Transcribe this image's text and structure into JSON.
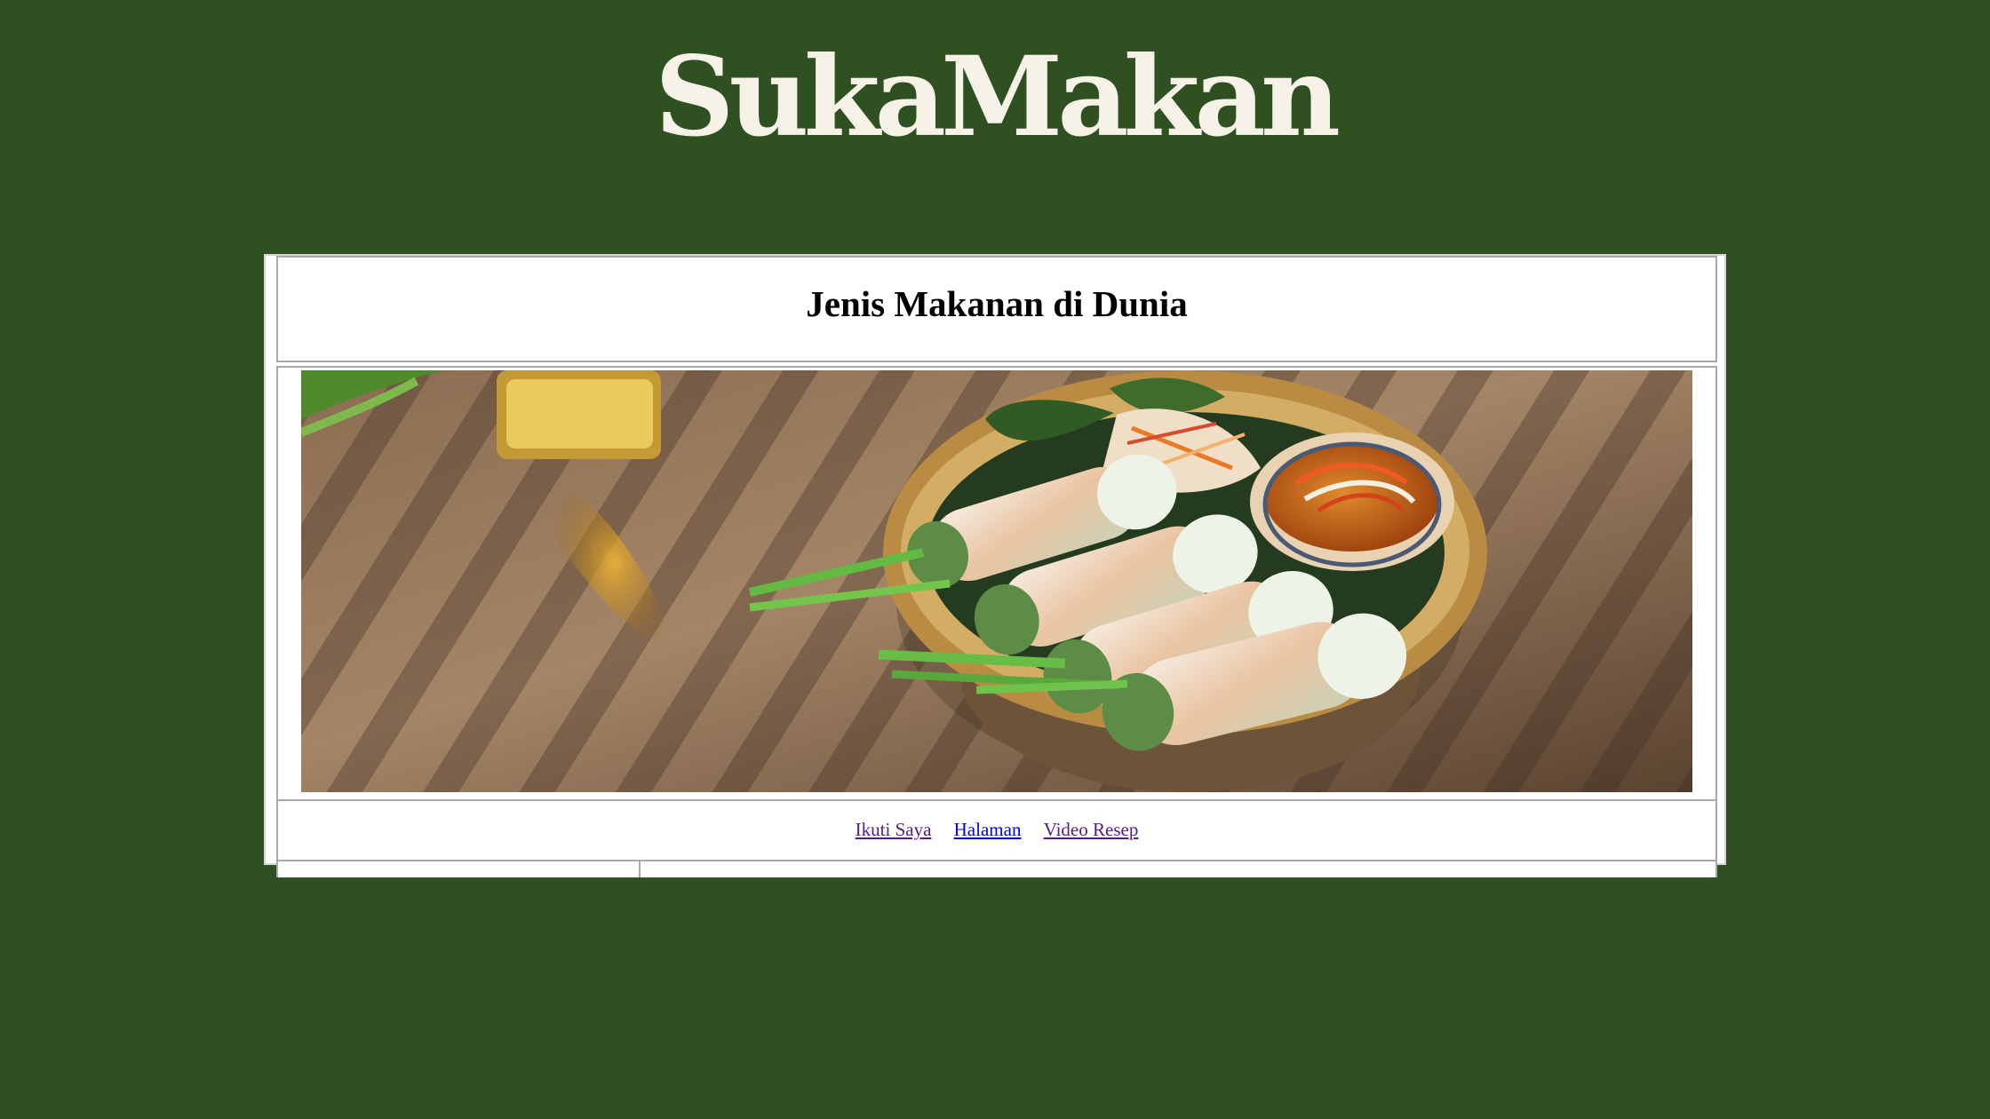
{
  "brand": {
    "logo_text": "SukaMakan"
  },
  "header": {
    "title": "Jenis Makanan di Dunia"
  },
  "hero": {
    "icon": "food-photo"
  },
  "nav": {
    "items": [
      {
        "label": "Ikuti Saya"
      },
      {
        "label": "Halaman"
      },
      {
        "label": "Video Resep"
      }
    ]
  },
  "colors": {
    "page_background": "#2f5020",
    "logo": "#f7f2e8",
    "visited_link": "#551a8b",
    "link": "#0000ee"
  }
}
